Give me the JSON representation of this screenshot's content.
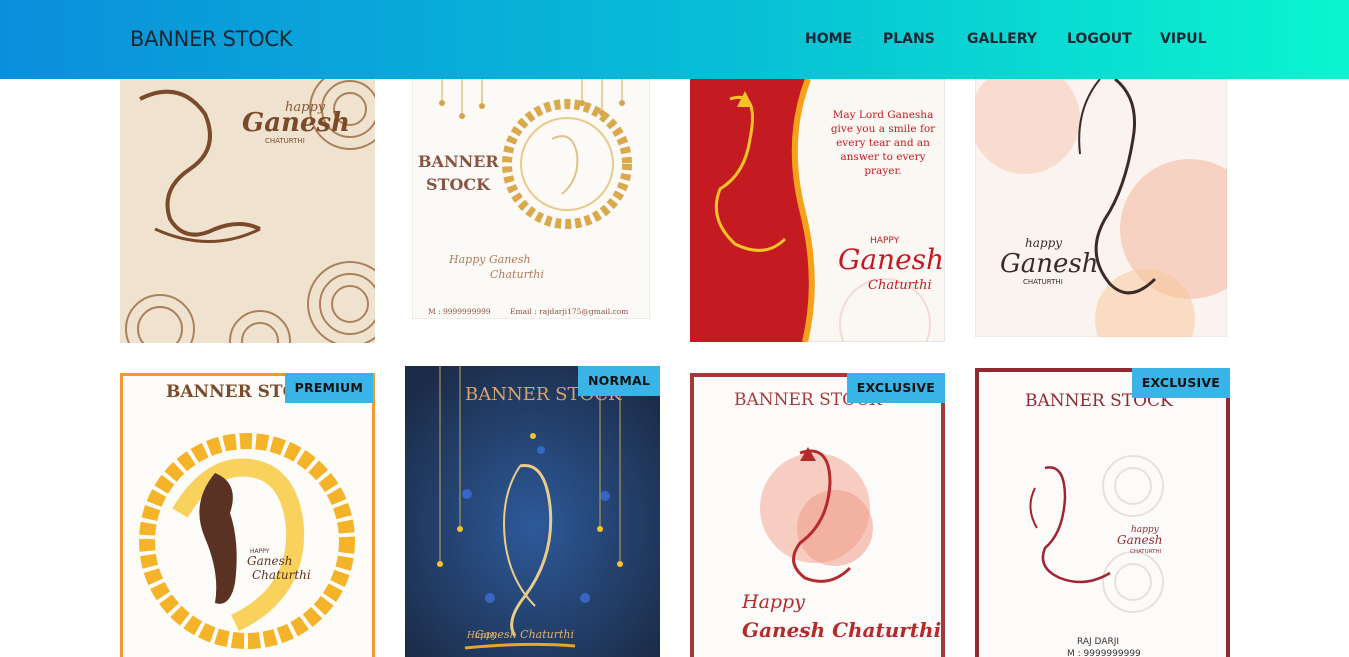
{
  "nav": {
    "brand": "BANNER STOCK",
    "links": [
      "HOME",
      "PLANS",
      "GALLERY",
      "LOGOUT",
      "VIPUL"
    ]
  },
  "cards_row1": [
    {
      "lines": [
        "happy",
        "Ganesh",
        "CHATURTHI"
      ]
    },
    {
      "lines": [
        "BANNER",
        "STOCK",
        "Happy Ganesh",
        "Chaturthi",
        "M : 9999999999",
        "Email : rajdarji175@gmail.com"
      ]
    },
    {
      "lines": [
        "May Lord Ganesha",
        "give you a smile for",
        "every tear and an",
        "answer to every",
        "prayer.",
        "HAPPY",
        "Ganesh",
        "Chaturthi"
      ]
    },
    {
      "lines": [
        "happy",
        "Ganesh",
        "CHATURTHI"
      ]
    }
  ],
  "cards_row2": [
    {
      "badge": "PREMIUM",
      "lines": [
        "BANNER STO",
        "HAPPY",
        "Ganesh",
        "Chaturthi"
      ]
    },
    {
      "badge": "NORMAL",
      "lines": [
        "BANNER STOCK",
        "Happy",
        "Ganesh Chaturthi"
      ]
    },
    {
      "badge": "EXCLUSIVE",
      "lines": [
        "BANNER STOCK",
        "Happy",
        "Ganesh Chaturthi"
      ]
    },
    {
      "badge": "EXCLUSIVE",
      "lines": [
        "BANNER STOCK",
        "happy",
        "Ganesh",
        "CHATURTHI",
        "RAJ DARJI",
        "M : 9999999999"
      ]
    }
  ],
  "colors": {
    "nav_start": "#0a8fdc",
    "nav_end": "#0af5cf",
    "badge": "#3ab4e6",
    "text_dark": "#1b2633"
  }
}
